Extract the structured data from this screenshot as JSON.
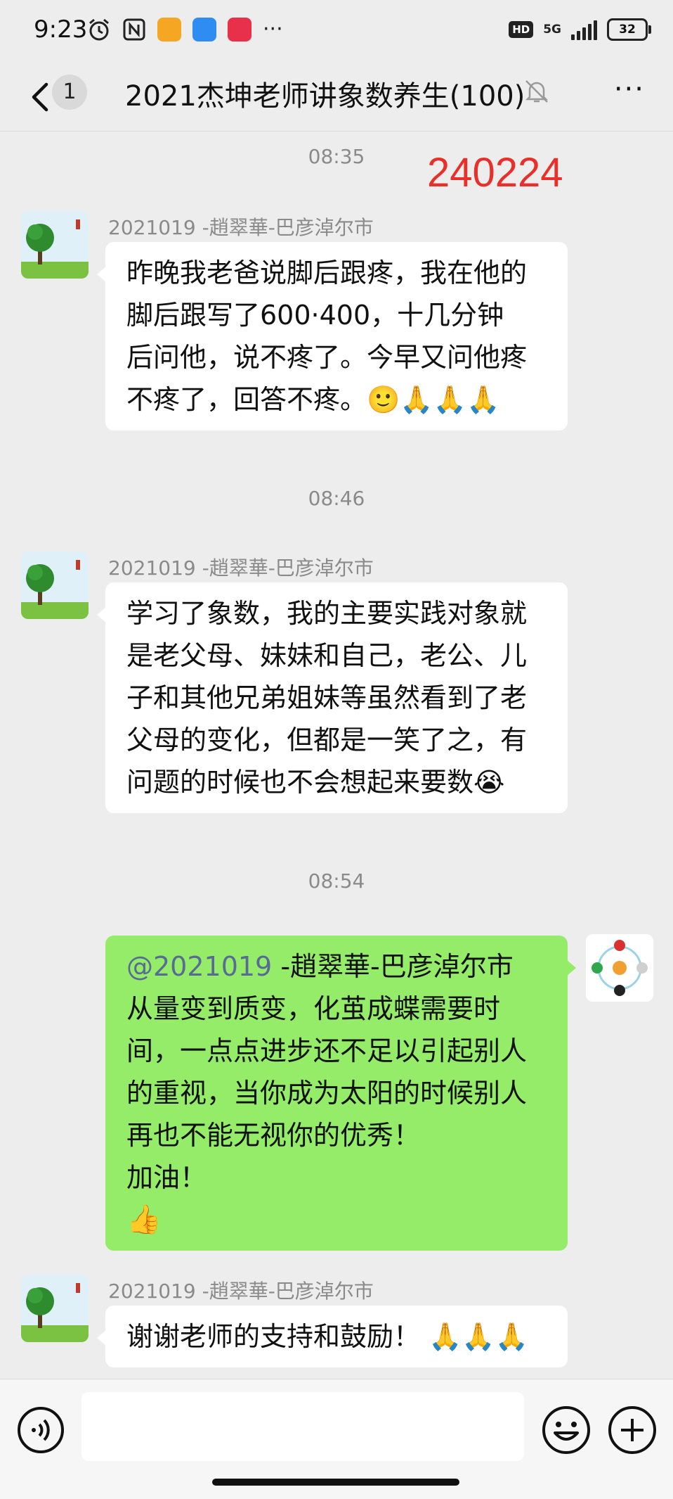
{
  "status_bar": {
    "time": "9:23",
    "network": "5G",
    "hd": "HD",
    "battery": "32",
    "dots": "···"
  },
  "nav": {
    "unread_count": "1",
    "title": "2021杰坤老师讲象数养生(100)",
    "more": "···"
  },
  "stamp": "240224",
  "messages": [
    {
      "time": "08:35",
      "sender": "2021019 -趙翠華-巴彦淖尔市",
      "lines": [
        "昨晚我老爸说脚后跟疼，我在他的",
        "脚后跟写了600·400，十几分钟",
        "后问他，说不疼了。今早又问他疼",
        "不疼了，回答不疼。🙂🙏🙏🙏"
      ]
    },
    {
      "time": "08:46",
      "sender": "2021019 -趙翠華-巴彦淖尔市",
      "lines": [
        "学习了象数，我的主要实践对象就",
        "是老父母、妹妹和自己，老公、儿",
        "子和其他兄弟姐妹等虽然看到了老",
        "父母的变化，但都是一笑了之，有",
        "问题的时候也不会想起来要数😭"
      ]
    },
    {
      "time": "08:54",
      "mention": "@2021019",
      "mention_rest": " -趙翠華-巴彦淖尔市",
      "lines": [
        "从量变到质变，化茧成蝶需要时",
        "间，一点点进步还不足以引起别人",
        "的重视，当你成为太阳的时候别人",
        "再也不能无视你的优秀！",
        "加油！",
        "👍"
      ]
    },
    {
      "sender": "2021019 -趙翠華-巴彦淖尔市",
      "lines": [
        "谢谢老师的支持和鼓励！ 🙏🙏🙏"
      ]
    }
  ],
  "colors": {
    "background": "#ededed",
    "self_bubble": "#95ec69",
    "other_bubble": "#ffffff",
    "mention": "#576b95",
    "stamp": "#e8302a"
  },
  "icons": [
    "back-arrow-icon",
    "mute-bell-icon",
    "more-icon",
    "voice-icon",
    "emoji-icon",
    "plus-icon",
    "alarm-icon",
    "nfc-icon"
  ]
}
